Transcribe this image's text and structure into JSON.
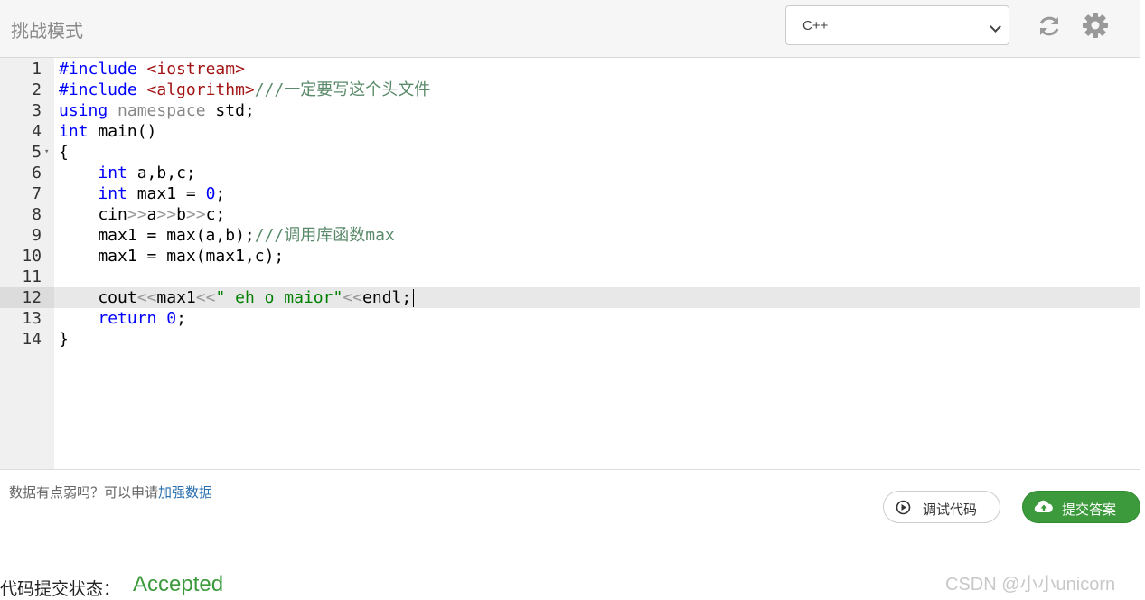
{
  "header": {
    "title": "挑战模式",
    "language": "C++"
  },
  "editor": {
    "lines": [
      {
        "n": "1",
        "tokens": [
          [
            "pp",
            "#include "
          ],
          [
            "str",
            "<iostream>"
          ]
        ]
      },
      {
        "n": "2",
        "tokens": [
          [
            "pp",
            "#include "
          ],
          [
            "str",
            "<algorithm>"
          ],
          [
            "cm",
            "///一定要写这个头文件"
          ]
        ]
      },
      {
        "n": "3",
        "tokens": [
          [
            "kw",
            "using "
          ],
          [
            "ns",
            "namespace "
          ],
          [
            "",
            "std;"
          ]
        ]
      },
      {
        "n": "4",
        "tokens": [
          [
            "kw",
            "int "
          ],
          [
            "",
            "main()"
          ]
        ]
      },
      {
        "n": "5",
        "tokens": [
          [
            "",
            "{"
          ]
        ],
        "fold": true
      },
      {
        "n": "6",
        "tokens": [
          [
            "",
            "    "
          ],
          [
            "kw",
            "int "
          ],
          [
            "",
            "a,b,c;"
          ]
        ]
      },
      {
        "n": "7",
        "tokens": [
          [
            "",
            "    "
          ],
          [
            "kw",
            "int "
          ],
          [
            "",
            "max1 = "
          ],
          [
            "num",
            "0"
          ],
          [
            "",
            ";"
          ]
        ]
      },
      {
        "n": "8",
        "tokens": [
          [
            "",
            "    cin"
          ],
          [
            "op",
            ">>"
          ],
          [
            "",
            "a"
          ],
          [
            "op",
            ">>"
          ],
          [
            "",
            "b"
          ],
          [
            "op",
            ">>"
          ],
          [
            "",
            "c;"
          ]
        ]
      },
      {
        "n": "9",
        "tokens": [
          [
            "",
            "    max1 = max(a,b);"
          ],
          [
            "cm",
            "///调用库函数max"
          ]
        ]
      },
      {
        "n": "10",
        "tokens": [
          [
            "",
            "    max1 = max(max1,c);"
          ]
        ]
      },
      {
        "n": "11",
        "tokens": []
      },
      {
        "n": "12",
        "tokens": [
          [
            "",
            "    cout"
          ],
          [
            "op",
            "<<"
          ],
          [
            "",
            "max1"
          ],
          [
            "op",
            "<<"
          ],
          [
            "str2",
            "\" eh o maior\""
          ],
          [
            "op",
            "<<"
          ],
          [
            "",
            "endl;"
          ]
        ],
        "active": true
      },
      {
        "n": "13",
        "tokens": [
          [
            "",
            "    "
          ],
          [
            "kw",
            "return "
          ],
          [
            "num",
            "0"
          ],
          [
            "",
            ";"
          ]
        ]
      },
      {
        "n": "14",
        "tokens": [
          [
            "",
            "}"
          ]
        ]
      }
    ]
  },
  "footer": {
    "hint_text": "数据有点弱吗？可以申请",
    "hint_link": "加强数据",
    "debug_label": "调试代码",
    "submit_label": "提交答案",
    "status_label": "代码提交状态：",
    "status_value": "Accepted",
    "watermark": "CSDN @小小unicorn"
  }
}
